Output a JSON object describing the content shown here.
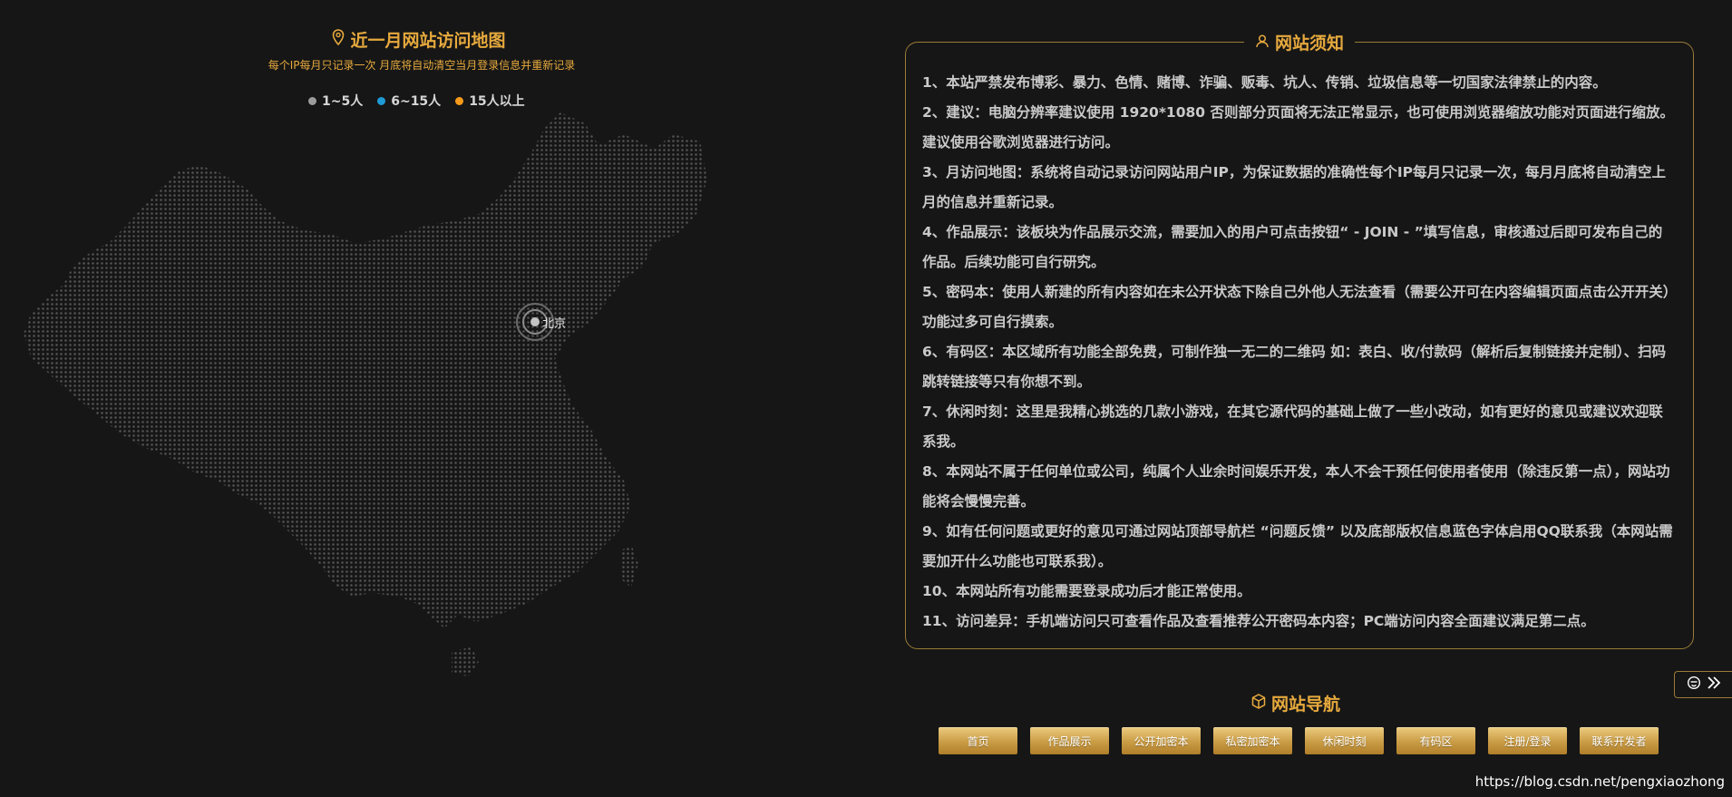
{
  "map": {
    "title_bright": "近一月网站访问地图",
    "title_dim": "",
    "subtitle": "每个IP每月只记录一次 月底将自动清空当月登录信息并重新记录",
    "legend": [
      {
        "label": "1~5人",
        "color": "#9c9c9c"
      },
      {
        "label": "6~15人",
        "color": "#1e9ad6"
      },
      {
        "label": "15人以上",
        "color": "#f59a1b"
      }
    ],
    "marker_label": "北京",
    "icon": "location-pin-icon"
  },
  "notice": {
    "title": "网站须知",
    "icon": "user-icon",
    "items": [
      "1、本站严禁发布博彩、暴力、色情、赌博、诈骗、贩毒、坑人、传销、垃圾信息等一切国家法律禁止的内容。",
      "2、建议：电脑分辨率建议使用 1920*1080 否则部分页面将无法正常显示，也可使用浏览器缩放功能对页面进行缩放。建议使用谷歌浏览器进行访问。",
      "3、月访问地图：系统将自动记录访问网站用户IP，为保证数据的准确性每个IP每月只记录一次，每月月底将自动清空上月的信息并重新记录。",
      "4、作品展示：该板块为作品展示交流，需要加入的用户可点击按钮“ - JOIN - ”填写信息，审核通过后即可发布自己的作品。后续功能可自行研究。",
      "5、密码本：使用人新建的所有内容如在未公开状态下除自己外他人无法查看（需要公开可在内容编辑页面点击公开开关）功能过多可自行摸索。",
      "6、有码区：本区域所有功能全部免费，可制作独一无二的二维码 如：表白、收/付款码（解析后复制链接并定制）、扫码跳转链接等只有你想不到。",
      "7、休闲时刻：这里是我精心挑选的几款小游戏，在其它源代码的基础上做了一些小改动，如有更好的意见或建议欢迎联系我。",
      "8、本网站不属于任何单位或公司，纯属个人业余时间娱乐开发，本人不会干预任何使用者使用（除违反第一点），网站功能将会慢慢完善。",
      "9、如有任何问题或更好的意见可通过网站顶部导航栏 “问题反馈” 以及底部版权信息蓝色字体启用QQ联系我（本网站需要加开什么功能也可联系我）。",
      "10、本网站所有功能需要登录成功后才能正常使用。",
      "11、访问差异：手机端访问只可查看作品及查看推荐公开密码本内容；PC端访问内容全面建议满足第二点。"
    ]
  },
  "nav": {
    "title": "网站导航",
    "icon": "cube-icon",
    "buttons": [
      "首页",
      "作品展示",
      "公开加密本",
      "私密加密本",
      "休闲时刻",
      "有码区",
      "注册/登录",
      "联系开发者"
    ]
  },
  "side_toggle": {
    "icons": [
      "face-icon",
      "double-chevron-right-icon"
    ]
  },
  "watermark": "https://blog.csdn.net/pengxiaozhong",
  "colors": {
    "accent": "#e6a93d",
    "border": "#9a7b37",
    "background": "#161616"
  }
}
